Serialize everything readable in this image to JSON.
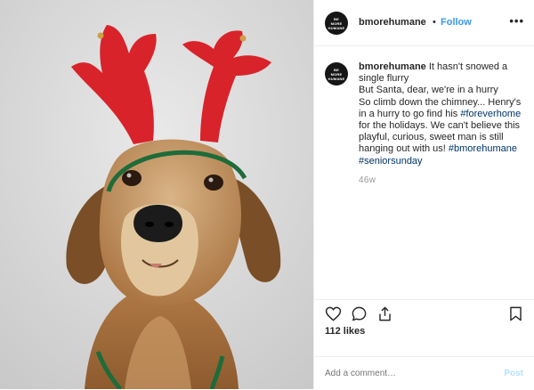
{
  "post": {
    "username": "bmorehumane",
    "dot": "•",
    "follow_label": "Follow",
    "more_label": "•••",
    "avatar_text": "BE MORE HUMANE",
    "caption": {
      "username": "bmorehumane",
      "line1": " It hasn't snowed a single flurry",
      "line2": "But Santa, dear, we're in a hurry",
      "line3": "So climb down the chimney... Henry's in a hurry to go find his ",
      "tag_forever": "#foreverhome",
      "line4": " for the holidays. We can't believe this playful, curious, sweet man is still hanging out with us! ",
      "tag_bmore": "#bmorehumane",
      "tag_senior": "#seniorsunday"
    },
    "time_ago": "46w",
    "likes": "112 likes",
    "comment_placeholder": "Add a comment…",
    "post_label": "Post"
  },
  "icons": {
    "like": "heart-icon",
    "comment": "comment-icon",
    "share": "share-icon",
    "save": "bookmark-icon"
  },
  "colors": {
    "link": "#3897f0",
    "hashtag": "#003569",
    "muted": "#999999",
    "antlers": "#d8232a"
  }
}
